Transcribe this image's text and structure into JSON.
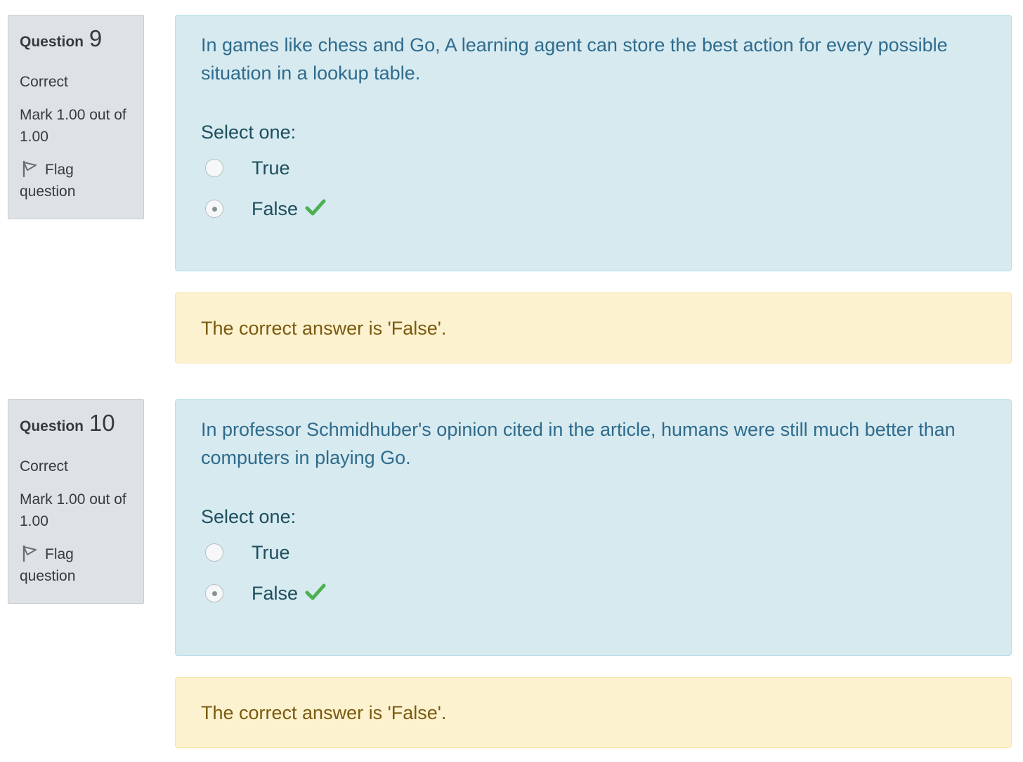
{
  "questions": [
    {
      "label": "Question",
      "number": "9",
      "state": "Correct",
      "grade": "Mark 1.00 out of 1.00",
      "flag_label": "Flag question",
      "text": "In games like chess and Go, A learning agent can store the best action for every possible situation in a lookup table.",
      "prompt": "Select one:",
      "options": [
        {
          "label": "True",
          "selected": false
        },
        {
          "label": "False",
          "selected": true,
          "correct_icon": "check-icon"
        }
      ],
      "feedback": "The correct answer is 'False'."
    },
    {
      "label": "Question",
      "number": "10",
      "state": "Correct",
      "grade": "Mark 1.00 out of 1.00",
      "flag_label": "Flag question",
      "text": "In professor Schmidhuber's opinion cited in the article, humans were still much better than computers in playing Go.",
      "prompt": "Select one:",
      "options": [
        {
          "label": "True",
          "selected": false
        },
        {
          "label": "False",
          "selected": true,
          "correct_icon": "check-icon"
        }
      ],
      "feedback": "The correct answer is 'False'."
    }
  ],
  "colors": {
    "info_bg": "#dee2e6",
    "formulation_bg": "#d6eaf0",
    "question_text": "#2f6b8c",
    "outcome_bg": "#fcf2cf",
    "feedback_text": "#7a5a10",
    "correct_check": "#4caf50"
  }
}
